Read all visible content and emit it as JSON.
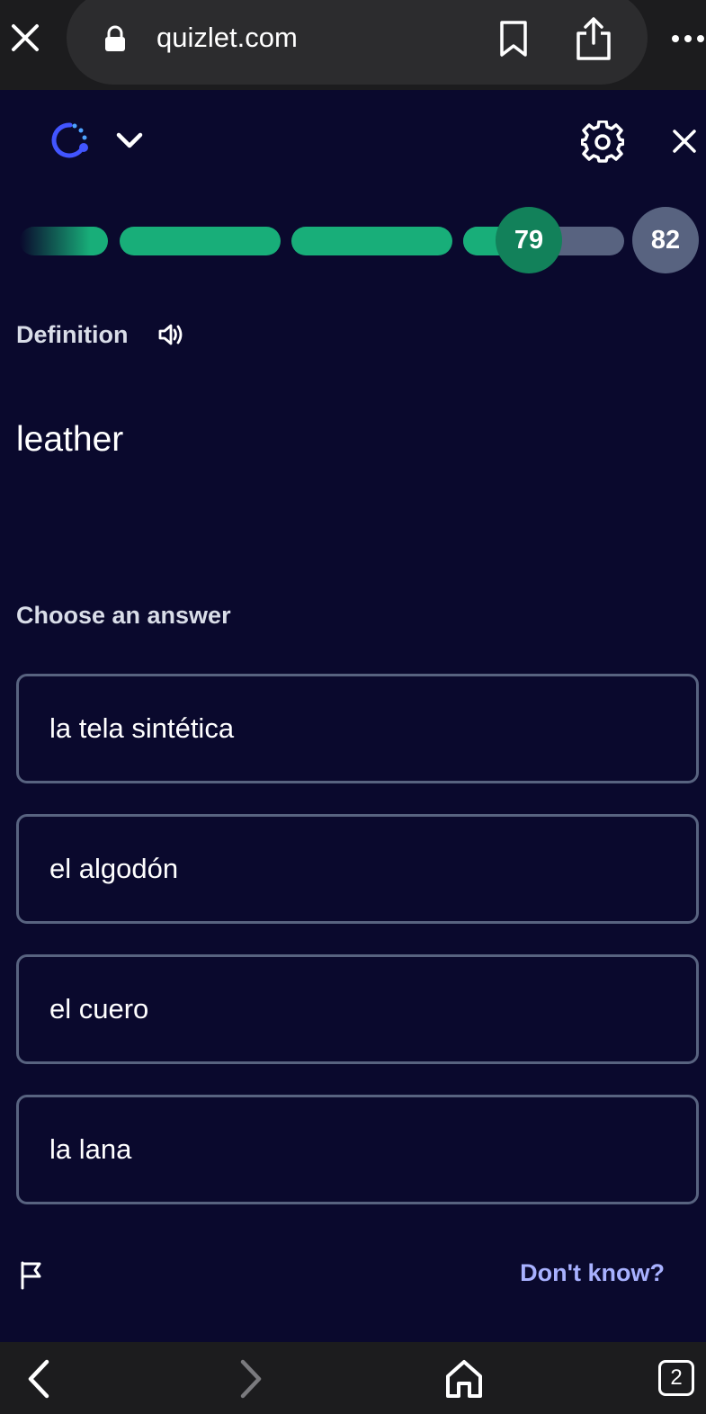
{
  "browser": {
    "url": "quizlet.com",
    "tab_count": "2"
  },
  "progress": {
    "current": "79",
    "total": "82",
    "current_segment_fill_percent": 40
  },
  "question": {
    "prompt_label": "Definition",
    "term": "leather",
    "choose_label": "Choose an answer"
  },
  "options": [
    {
      "label": "la tela sintética"
    },
    {
      "label": "el algodón"
    },
    {
      "label": "el cuero"
    },
    {
      "label": "la lana"
    }
  ],
  "footer": {
    "dont_know_label": "Don't know?"
  },
  "colors": {
    "background": "#0a092d",
    "progress_green": "#18ae79",
    "current_bubble": "#12815a",
    "pending_gray": "#586380",
    "link_blue": "#a8b1ff"
  }
}
